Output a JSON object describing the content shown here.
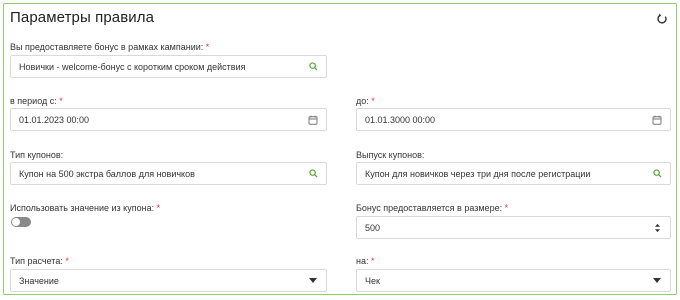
{
  "panel": {
    "title": "Параметры правила",
    "reset_icon": "reset-icon",
    "accent": "#8fcf6a"
  },
  "campaign": {
    "label": "Вы предоставляете бонус в рамках кампании:",
    "required": "*",
    "value": "Новички - welcome-бонус с коротким сроком действия",
    "icon": "search-icon"
  },
  "period_from": {
    "label": "в период с:",
    "required": "*",
    "value": "01.01.2023 00:00",
    "icon": "calendar-icon"
  },
  "period_to": {
    "label": "до:",
    "required": "*",
    "value": "01.01.3000 00:00",
    "icon": "calendar-icon"
  },
  "coupon_type": {
    "label": "Тип купонов:",
    "value": "Купон на 500 экстра баллов для новичков",
    "icon": "search-icon"
  },
  "coupon_issue": {
    "label": "Выпуск купонов:",
    "value": "Купон для новичков через три дня после регистрации",
    "icon": "search-icon"
  },
  "use_coupon_value": {
    "label": "Использовать значение из купона:",
    "required": "*",
    "enabled": false
  },
  "bonus_amount": {
    "label": "Бонус предоставляется в размере:",
    "required": "*",
    "value": "500"
  },
  "calc_type": {
    "label": "Тип расчета:",
    "required": "*",
    "value": "Значение"
  },
  "calc_on": {
    "label": "на:",
    "required": "*",
    "value": "Чек"
  },
  "colors": {
    "required": "#e53935",
    "search_icon": "#5aa832",
    "toggle_off": "#8a8a8a",
    "border": "#d9d9d9"
  }
}
